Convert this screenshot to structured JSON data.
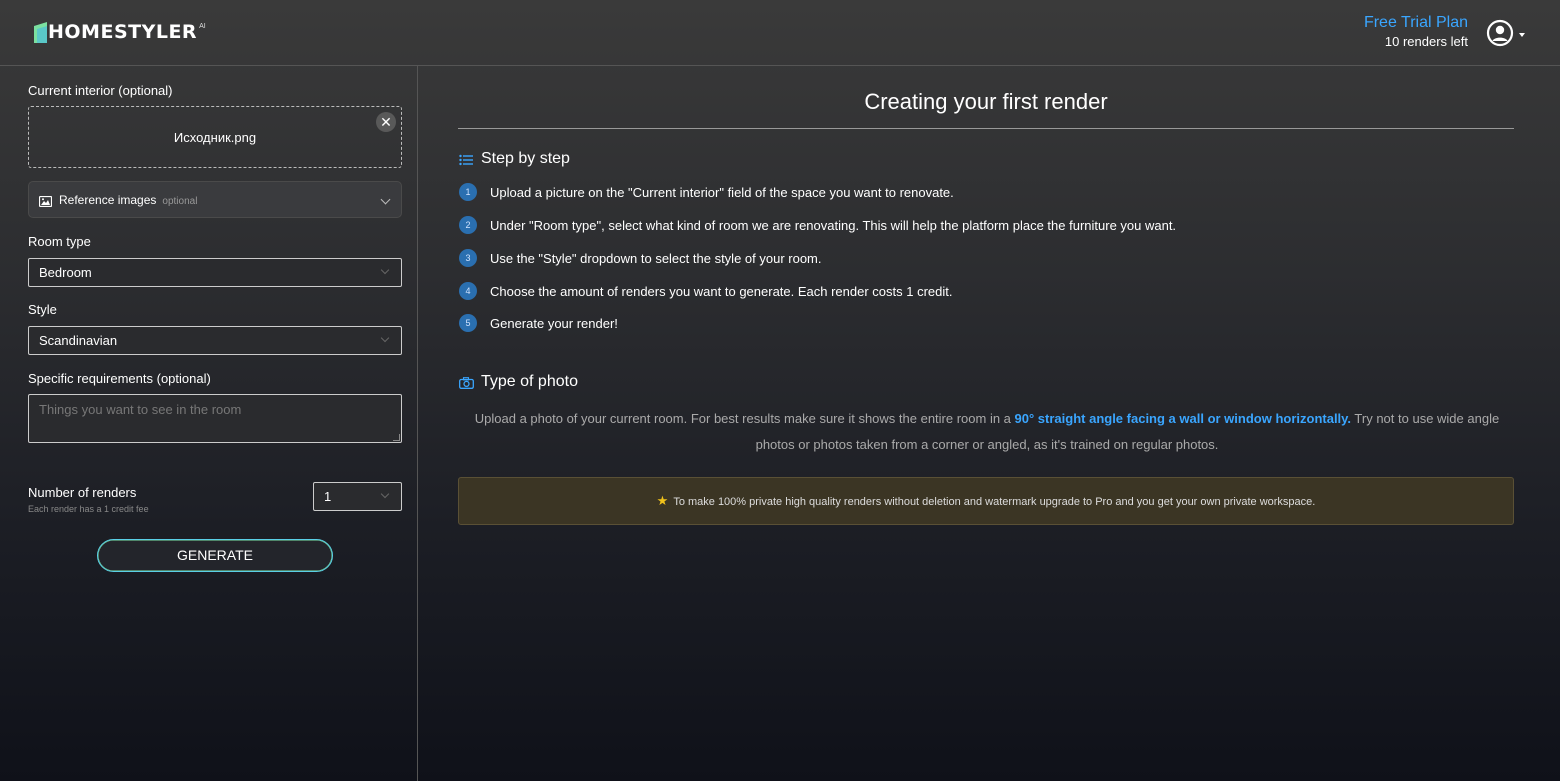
{
  "header": {
    "logo_text": "HOMESTYLER",
    "logo_suffix": "AI",
    "plan_name": "Free Trial Plan",
    "renders_left": "10 renders left"
  },
  "sidebar": {
    "current_interior_label": "Current interior (optional)",
    "uploaded_file": "Исходник.png",
    "close_glyph": "✕",
    "reference_label": "Reference images",
    "reference_optional": "optional",
    "room_type_label": "Room type",
    "room_type_value": "Bedroom",
    "style_label": "Style",
    "style_value": "Scandinavian",
    "requirements_label": "Specific requirements (optional)",
    "requirements_placeholder": "Things you want to see in the room",
    "num_renders_label": "Number of renders",
    "num_renders_sub": "Each render has a 1 credit fee",
    "num_renders_value": "1",
    "generate_label": "GENERATE"
  },
  "main": {
    "title": "Creating your first render",
    "steps_heading": "Step by step",
    "steps": [
      {
        "num": "1",
        "text": "Upload a picture on the \"Current interior\" field of the space you want to renovate."
      },
      {
        "num": "2",
        "text": "Under \"Room type\", select what kind of room we are renovating. This will help the platform place the furniture you want."
      },
      {
        "num": "3",
        "text": "Use the \"Style\" dropdown to select the style of your room."
      },
      {
        "num": "4",
        "text": "Choose the amount of renders you want to generate. Each render costs 1 credit."
      },
      {
        "num": "5",
        "text": "Generate your render!"
      }
    ],
    "photo_heading": "Type of photo",
    "photo_text_1": "Upload a photo of your current room. For best results make sure it shows the entire room in a ",
    "photo_text_highlight": "90° straight angle facing a wall or window horizontally.",
    "photo_text_2": " Try not to use wide angle photos or photos taken from a corner or angled, as it's trained on regular photos.",
    "pro_notice": "To make 100% private high quality renders without deletion and watermark upgrade to Pro and you get your own private workspace.",
    "star_glyph": "★"
  },
  "colors": {
    "accent_blue": "#3aa6ff",
    "step_badge": "#2a6fb0",
    "notice_bg": "#3b3524",
    "star": "#f1c21b"
  }
}
